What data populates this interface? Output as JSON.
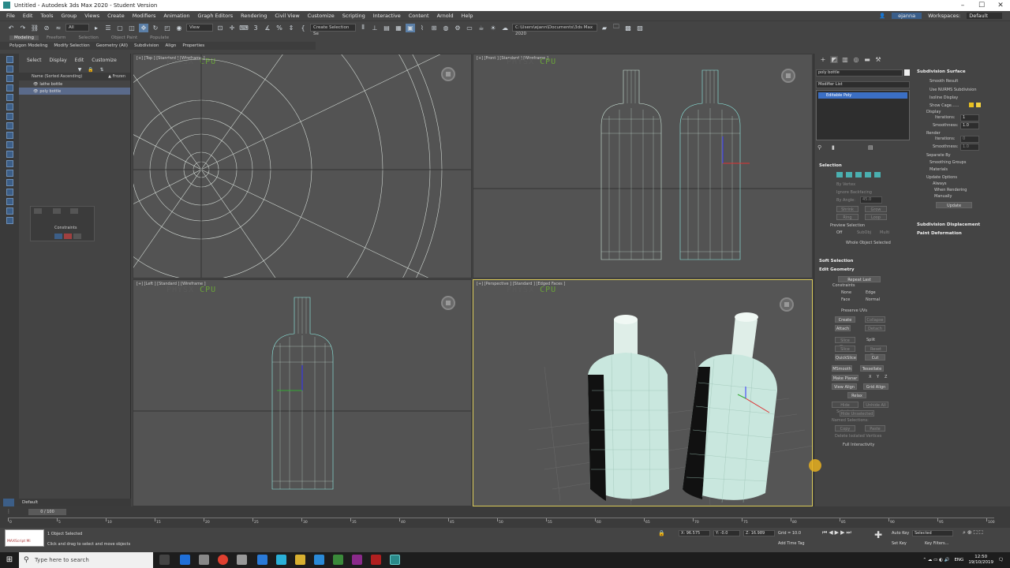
{
  "window": {
    "title": "Untitled - Autodesk 3ds Max 2020 - Student Version"
  },
  "menu": [
    "File",
    "Edit",
    "Tools",
    "Group",
    "Views",
    "Create",
    "Modifiers",
    "Animation",
    "Graph Editors",
    "Rendering",
    "Civil View",
    "Customize",
    "Scripting",
    "Interactive",
    "Content",
    "Arnold",
    "Help"
  ],
  "user": {
    "name": "ejanna",
    "workspaces_label": "Workspaces:",
    "workspace": "Default"
  },
  "toolbar": {
    "filter": "All",
    "ref_coord": "View",
    "selection_set": "Create Selection Se",
    "project_path": "C:\\Users\\ejann\\Documents\\3ds Max 2020"
  },
  "ribbon": {
    "tabs": [
      "Modeling",
      "Freeform",
      "Selection",
      "Object Paint",
      "Populate"
    ],
    "sub": [
      "Polygon Modeling",
      "Modify Selection",
      "Geometry (All)",
      "Subdivision",
      "Align",
      "Properties"
    ]
  },
  "scene_explorer": {
    "tabs": [
      "Select",
      "Display",
      "Edit",
      "Customize"
    ],
    "col_name": "Name (Sorted Ascending)",
    "col_frozen": "▲ Frozen",
    "items": [
      {
        "name": "lathe bottle",
        "selected": false
      },
      {
        "name": "poly bottle",
        "selected": true
      }
    ],
    "layer": "Default",
    "constraints_label": "Constraints"
  },
  "viewports": {
    "top": {
      "label": "[+] [Top ] [Standard ] [Wireframe ]"
    },
    "front": {
      "label": "[+] [Front ] [Standard ] [Wireframe ]"
    },
    "left": {
      "label": "[+] [Left ] [Standard ] [Wireframe ]"
    },
    "persp": {
      "label": "[+] [Perspective ] [Standard ] [Edged Faces ]"
    },
    "physx_text": "PHYSX",
    "cpu_text": "CPU"
  },
  "command_panel": {
    "object_name": "poly bottle",
    "modifier_list": "Modifier List",
    "stack_item": "Editable Poly",
    "selection": {
      "title": "Selection",
      "by_vertex": "By Vertex",
      "ignore_backfacing": "Ignore Backfacing",
      "by_angle": "By Angle:",
      "angle_value": "45.0",
      "shrink": "Shrink",
      "grow": "Grow",
      "ring": "Ring",
      "loop": "Loop",
      "preview_title": "Preview Selection",
      "preview_off": "Off",
      "preview_subobj": "SubObj",
      "preview_multi": "Multi",
      "status": "Whole Object Selected"
    },
    "soft_selection": "Soft Selection",
    "edit_geometry": {
      "title": "Edit Geometry",
      "repeat_last": "Repeat Last",
      "constraints": "Constraints",
      "none": "None",
      "edge": "Edge",
      "face": "Face",
      "normal": "Normal",
      "preserve_uvs": "Preserve UVs",
      "create": "Create",
      "collapse": "Collapse",
      "attach": "Attach",
      "detach": "Detach",
      "slice_plane": "Slice Plane",
      "split": "Split",
      "slice": "Slice",
      "reset_plane": "Reset Plane",
      "quickslice": "QuickSlice",
      "cut": "Cut",
      "msmooth": "MSmooth",
      "tessellate": "Tessellate",
      "make_planar": "Make Planar",
      "x": "X",
      "y": "Y",
      "z": "Z",
      "view_align": "View Align",
      "grid_align": "Grid Align",
      "relax": "Relax",
      "hide_selected": "Hide Selected",
      "unhide_all": "Unhide All",
      "hide_unselected": "Hide Unselected",
      "named_selections": "Named Selections:",
      "copy": "Copy",
      "paste": "Paste",
      "delete_isolated": "Delete Isolated Vertices",
      "full_interactivity": "Full Interactivity"
    },
    "subdivision": {
      "title": "Subdivision Surface",
      "smooth_result": "Smooth Result",
      "use_nurms": "Use NURMS Subdivision",
      "isoline": "Isoline Display",
      "show_cage": "Show Cage......",
      "display": "Display",
      "iterations_label": "Iterations:",
      "iterations": "1",
      "smoothness_label": "Smoothness:",
      "smoothness": "1.0",
      "render": "Render",
      "r_iterations": "0",
      "r_smoothness": "1.0",
      "separate_by": "Separate By",
      "smoothing_groups": "Smoothing Groups",
      "materials": "Materials",
      "update_options": "Update Options",
      "always": "Always",
      "when_rendering": "When Rendering",
      "manually": "Manually",
      "update": "Update",
      "displacement": "Subdivision Displacement",
      "paint_deformation": "Paint Deformation"
    }
  },
  "timeline": {
    "frame": "0 / 100",
    "ticks": [
      "0",
      "5",
      "10",
      "15",
      "20",
      "25",
      "30",
      "35",
      "40",
      "45",
      "50",
      "55",
      "60",
      "65",
      "70",
      "75",
      "80",
      "85",
      "90",
      "95",
      "100"
    ]
  },
  "status": {
    "maxscript": "MAXScript Mi",
    "selected": "1 Object Selected",
    "prompt": "Click and drag to select and move objects",
    "x": "X: 96.575",
    "y": "Y: -0.0",
    "z": "Z: 16.989",
    "grid": "Grid = 10.0",
    "add_time_tag": "Add Time Tag",
    "auto_key": "Auto Key",
    "set_key": "Set Key",
    "key_mode": "Selected",
    "key_filters": "Key Filters..."
  },
  "taskbar": {
    "search": "Type here to search",
    "lang": "ENG",
    "time": "12:50",
    "date": "19/10/2019"
  }
}
